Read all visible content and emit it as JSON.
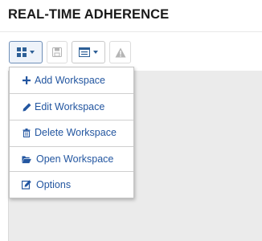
{
  "header": {
    "title": "REAL-TIME ADHERENCE"
  },
  "toolbar": {
    "buttons": [
      {
        "icon": "grid-icon",
        "has_caret": true,
        "state": "active"
      },
      {
        "icon": "save-icon",
        "has_caret": false,
        "state": "disabled"
      },
      {
        "icon": "list-view-icon",
        "has_caret": true,
        "state": "normal"
      },
      {
        "icon": "warning-icon",
        "has_caret": false,
        "state": "disabled"
      }
    ]
  },
  "menu": {
    "items": [
      {
        "label": "Add Workspace",
        "icon": "plus-icon"
      },
      {
        "label": "Edit Workspace",
        "icon": "pencil-icon"
      },
      {
        "label": "Delete Workspace",
        "icon": "trash-icon"
      },
      {
        "label": "Open Workspace",
        "icon": "folder-open-icon"
      },
      {
        "label": "Options",
        "icon": "edit-square-icon"
      }
    ]
  },
  "colors": {
    "accent": "#2356a0",
    "workspace_bg": "#ebebeb",
    "disabled": "#b5b5b5"
  }
}
